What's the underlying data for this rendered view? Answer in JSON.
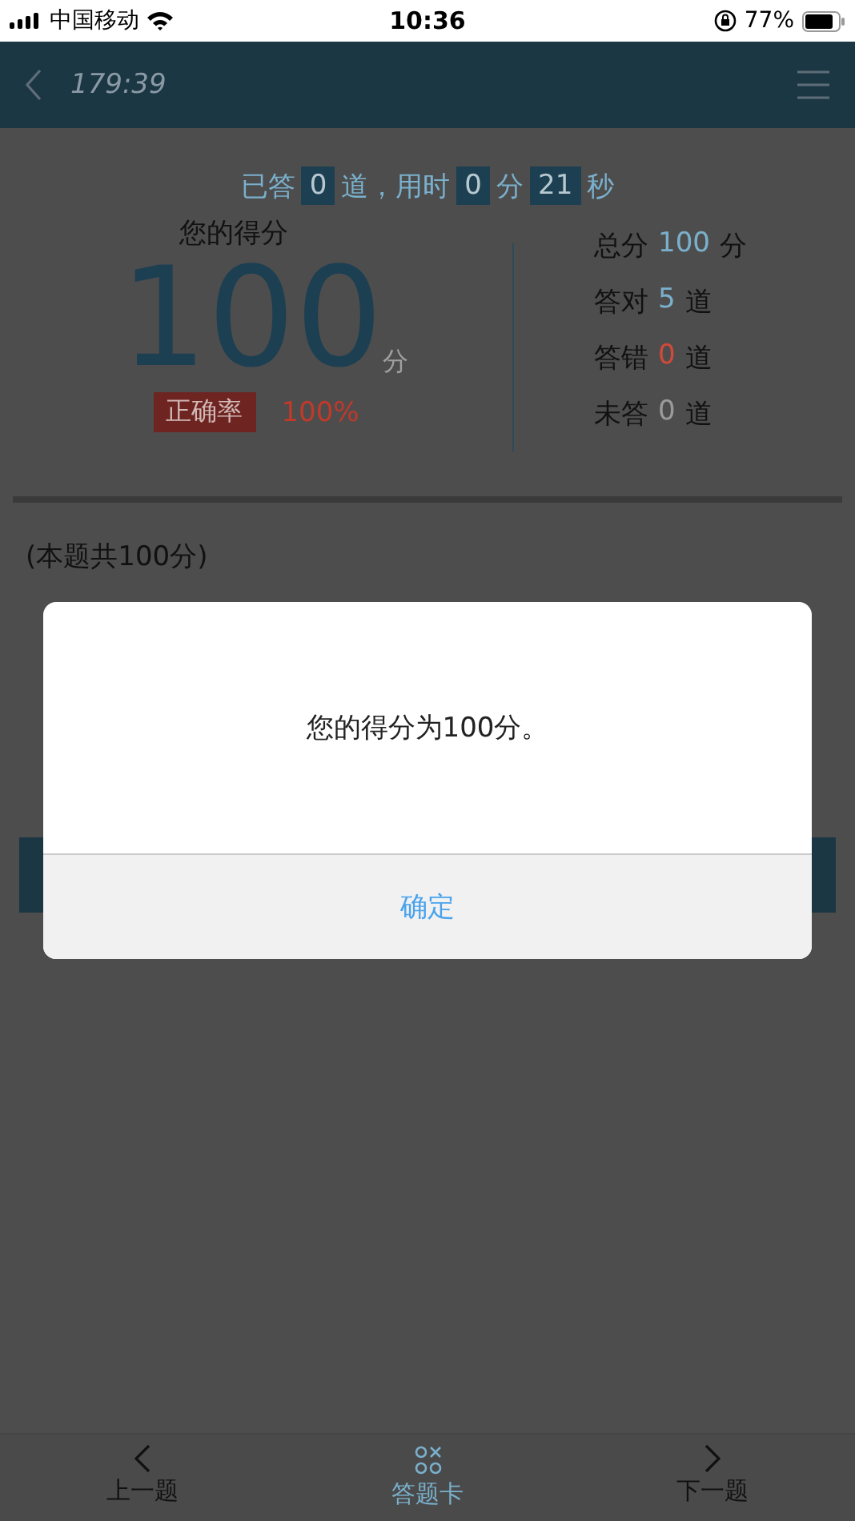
{
  "status_bar": {
    "carrier": "中国移动",
    "time": "10:36",
    "battery": "77%"
  },
  "header": {
    "timer": "179:39"
  },
  "progress": [
    {
      "text": "已答",
      "boxed": false
    },
    {
      "text": "0",
      "boxed": true
    },
    {
      "text": "道，用时",
      "boxed": false
    },
    {
      "text": "0",
      "boxed": true
    },
    {
      "text": "分",
      "boxed": false
    },
    {
      "text": "21",
      "boxed": true
    },
    {
      "text": "秒",
      "boxed": false
    }
  ],
  "score": {
    "label": "您的得分",
    "value": "100",
    "unit": "分",
    "rate_label": "正确率",
    "rate": "100%"
  },
  "stats": [
    {
      "label": "总分",
      "value": "100",
      "unit": "分",
      "color": "#7ab0cc"
    },
    {
      "label": "答对",
      "value": "5",
      "unit": "道",
      "color": "#7ab0cc"
    },
    {
      "label": "答错",
      "value": "0",
      "unit": "道",
      "color": "#d04a3c"
    },
    {
      "label": "未答",
      "value": "0",
      "unit": "道",
      "color": "#9a9a9a"
    }
  ],
  "question_note": "(本题共100分)",
  "dialog": {
    "message": "您的得分为100分。",
    "button": "确定"
  },
  "bottom_nav": [
    {
      "label": "上一题",
      "kind": "prev",
      "selected": false
    },
    {
      "label": "答题卡",
      "kind": "card",
      "selected": true
    },
    {
      "label": "下一题",
      "kind": "next",
      "selected": false
    }
  ]
}
